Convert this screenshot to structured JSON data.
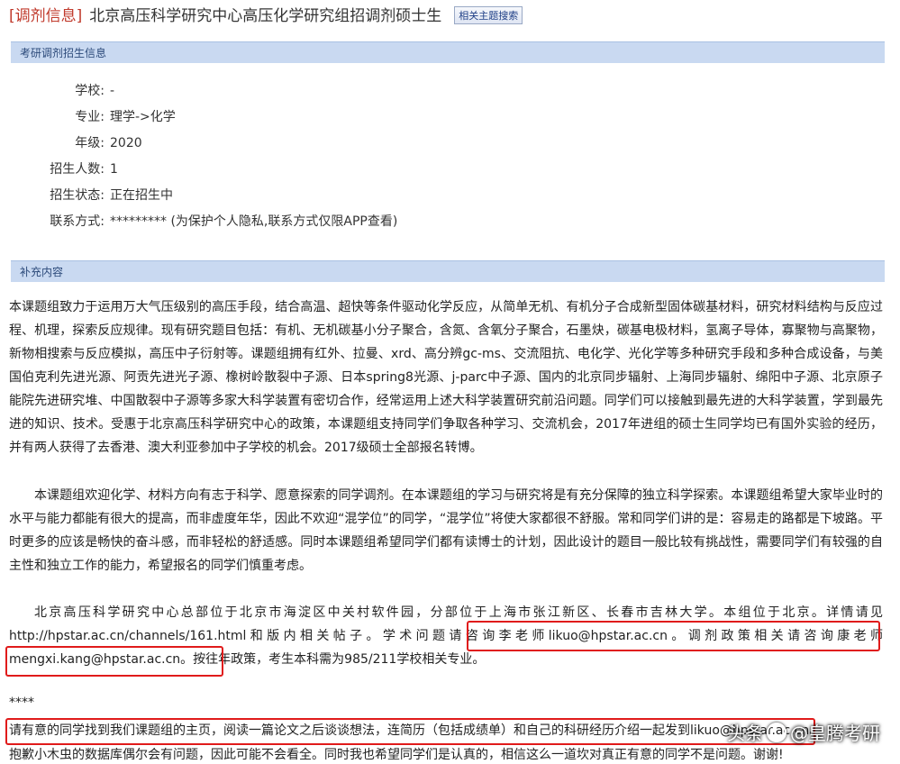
{
  "header": {
    "tag": "[调剂信息]",
    "title": "北京高压科学研究中心高压化学研究组招调剂硕士生",
    "topic_button": "相关主题搜索"
  },
  "section1": {
    "heading": "考研调剂招生信息",
    "rows": [
      {
        "label": "学校:",
        "value": "-"
      },
      {
        "label": "专业:",
        "value": "理学->化学"
      },
      {
        "label": "年级:",
        "value": "2020"
      },
      {
        "label": "招生人数:",
        "value": "1"
      },
      {
        "label": "招生状态:",
        "value": "正在招生中"
      },
      {
        "label": "联系方式:",
        "value": "********* (为保护个人隐私,联系方式仅限APP查看)"
      }
    ]
  },
  "section2": {
    "heading": "补充内容",
    "p1": "本课题组致力于运用万大气压级别的高压手段，结合高温、超快等条件驱动化学反应，从简单无机、有机分子合成新型固体碳基材料，研究材料结构与反应过程、机理，探索反应规律。现有研究题目包括：有机、无机碳基小分子聚合，含氮、含氧分子聚合，石墨炔，碳基电极材料，氢离子导体，寡聚物与高聚物，新物相搜索与反应模拟，高压中子衍射等。课题组拥有红外、拉曼、xrd、高分辨gc-ms、交流阻抗、电化学、光化学等多种研究手段和多种合成设备，与美国伯克利先进光源、阿贡先进光子源、橡树岭散裂中子源、日本spring8光源、j-parc中子源、国内的北京同步辐射、上海同步辐射、绵阳中子源、北京原子能院先进研究堆、中国散裂中子源等多家大科学装置有密切合作，经常运用上述大科学装置研究前沿问题。同学们可以接触到最先进的大科学装置，学到最先进的知识、技术。受惠于北京高压科学研究中心的政策，本课题组支持同学们争取各种学习、交流机会，2017年进组的硕士生同学均已有国外实验的经历，并有两人获得了去香港、澳大利亚参加中子学校的机会。2017级硕士全部报名转博。",
    "p2": "本课题组欢迎化学、材料方向有志于科学、愿意探索的同学调剂。在本课题组的学习与研究将是有充分保障的独立科学探索。本课题组希望大家毕业时的水平与能力都能有很大的提高，而非虚度年华，因此不欢迎“混学位”的同学，“混学位”将使大家都很不舒服。常和同学们讲的是：容易走的路都是下坡路。平时更多的应该是畅快的奋斗感，而非轻松的舒适感。同时本课题组希望同学们都有读博士的计划，因此设计的题目一般比较有挑战性，需要同学们有较强的自主性和独立工作的能力，希望报名的同学们慎重考虑。",
    "p3": "北京高压科学研究中心总部位于北京市海淀区中关村软件园，分部位于上海市张江新区、长春市吉林大学。本组位于北京。详情请见http://hpstar.ac.cn/channels/161.html和版内相关帖子。学术问题请咨询李老师likuo@hpstar.ac.cn。调剂政策相关请咨询康老师mengxi.kang@hpstar.ac.cn。按往年政策，考生本科需为985/211学校相关专业。",
    "stars": "****",
    "line1": "请有意的同学找到我们课题组的主页，阅读一篇论文之后谈谈想法，连简历（包括成绩单）和自己的科研经历介绍一起发到likuo@hpstar.ac.cn。",
    "line2": "抱歉小木虫的数据库偶尔会有问题，因此可能不会看全。同时我也希望同学们是认真的，相信这么一道坎对真正有意的同学不是问题。谢谢!"
  },
  "watermark": {
    "prefix": "头条",
    "at": "@",
    "name": "皇腾考研"
  }
}
